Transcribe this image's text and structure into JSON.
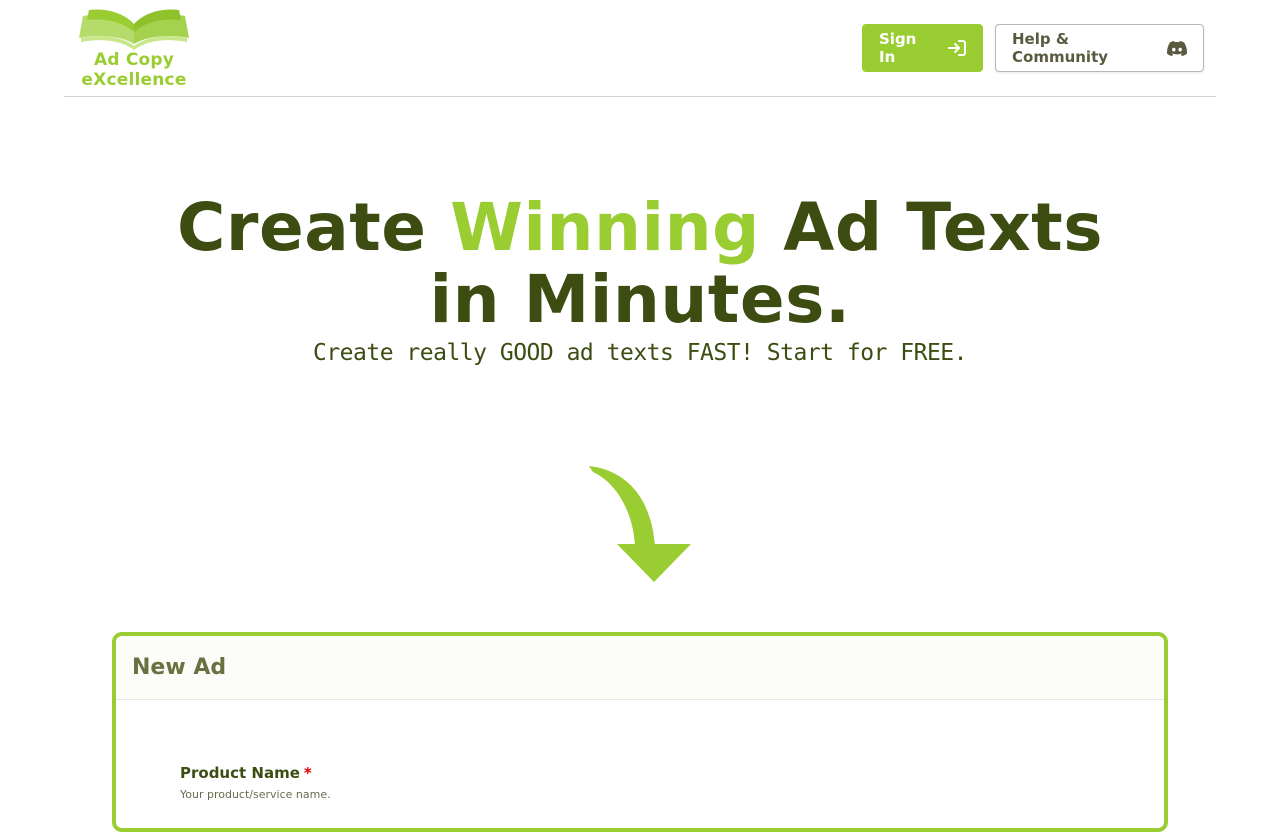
{
  "logo": {
    "line1": "Ad Copy",
    "line2": "eXcellence"
  },
  "nav": {
    "sign_in": {
      "label": "Sign In",
      "icon": "sign-in-icon"
    },
    "help": {
      "label": "Help & Community",
      "icon": "discord-icon"
    }
  },
  "hero": {
    "title_before": "Create",
    "title_accent": "Winning",
    "title_after": "Ad Texts in Minutes.",
    "subtitle": "Create really GOOD ad texts FAST! Start for FREE."
  },
  "form": {
    "title": "New Ad",
    "fields": [
      {
        "label": "Product Name",
        "required_mark": "*",
        "help": "Your product/service name."
      }
    ]
  },
  "colors": {
    "accent": "#9acd32",
    "dark": "#3d4d12"
  }
}
